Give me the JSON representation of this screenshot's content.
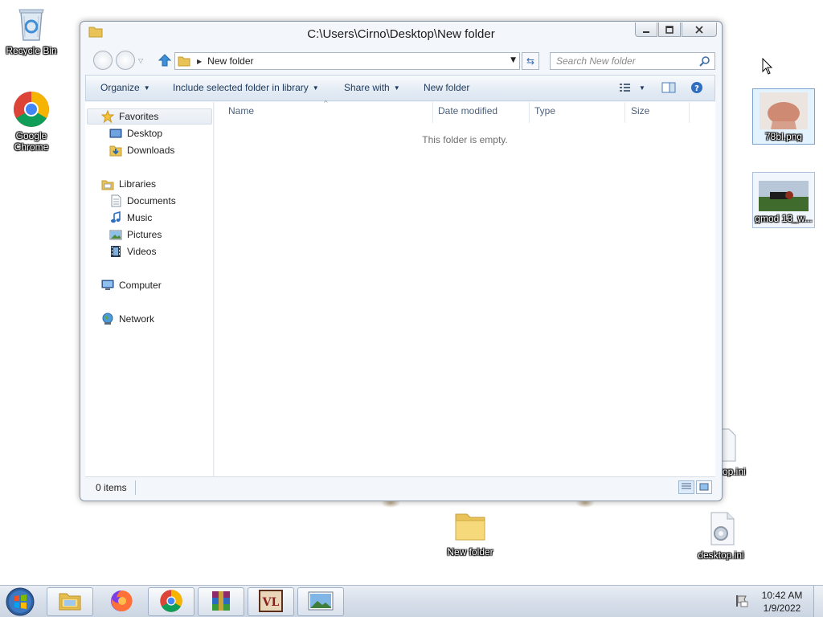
{
  "desktop": {
    "icons": [
      {
        "label": "Recycle Bin",
        "icon": "recycle-bin-icon"
      },
      {
        "label": "Google Chrome",
        "icon": "chrome-icon"
      },
      {
        "label": "78bl.png",
        "icon": "image-file-icon"
      },
      {
        "label": "gmod 13_w...",
        "icon": "image-file-icon"
      },
      {
        "label": "desktop.ini",
        "icon": "settings-file-icon"
      },
      {
        "label": "New folder",
        "icon": "folder-icon"
      },
      {
        "label": "desktop.ini",
        "icon": "settings-file-icon"
      }
    ]
  },
  "window": {
    "title": "C:\\Users\\Cirno\\Desktop\\New folder",
    "address": {
      "crumb": "New folder"
    },
    "search": {
      "placeholder": "Search New folder"
    },
    "commands": {
      "organize": "Organize",
      "include": "Include selected folder in library",
      "share": "Share with",
      "new_folder": "New folder"
    },
    "nav": {
      "favorites": "Favorites",
      "desktop": "Desktop",
      "downloads": "Downloads",
      "libraries": "Libraries",
      "documents": "Documents",
      "music": "Music",
      "pictures": "Pictures",
      "videos": "Videos",
      "computer": "Computer",
      "network": "Network"
    },
    "columns": {
      "name": "Name",
      "date_modified": "Date modified",
      "type": "Type",
      "size": "Size"
    },
    "empty_message": "This folder is empty.",
    "status": "0 items"
  },
  "taskbar": {
    "pinned": [
      "windows-explorer-icon",
      "firefox-icon",
      "chrome-icon",
      "winrar-icon",
      "vl-app-icon",
      "image-viewer-icon"
    ],
    "clock": {
      "time": "10:42 AM",
      "date": "1/9/2022"
    }
  },
  "colors": {
    "accent": "#3b6cb0",
    "command_text": "#1e395b",
    "column_header_text": "#4c607a",
    "window_frame": "#f3f6fa"
  }
}
